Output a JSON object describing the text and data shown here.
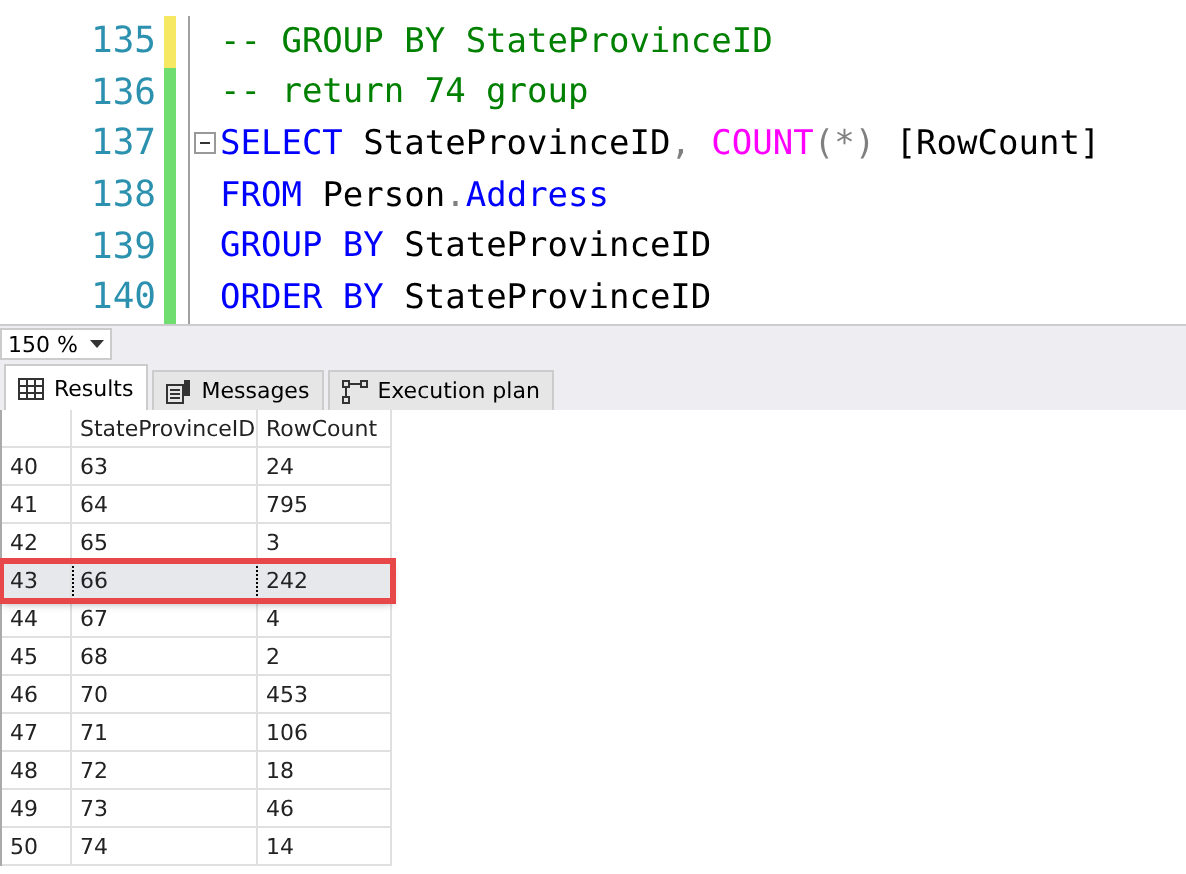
{
  "editor": {
    "lines": [
      {
        "number": "135",
        "kind": "unsaved",
        "collapsible": false,
        "tokens": [
          {
            "kind": "comment",
            "text": "-- GROUP BY StateProvinceID"
          }
        ]
      },
      {
        "number": "136",
        "kind": "saved",
        "collapsible": false,
        "tokens": [
          {
            "kind": "comment",
            "text": "-- return 74 group"
          }
        ]
      },
      {
        "number": "137",
        "kind": "saved",
        "collapsible": true,
        "tokens": [
          {
            "kind": "keyword",
            "text": "SELECT"
          },
          {
            "kind": "plain",
            "text": " StateProvinceID"
          },
          {
            "kind": "operator",
            "text": ", "
          },
          {
            "kind": "function",
            "text": "COUNT"
          },
          {
            "kind": "operator",
            "text": "(*)"
          },
          {
            "kind": "plain",
            "text": " [RowCount]"
          }
        ]
      },
      {
        "number": "138",
        "kind": "saved",
        "collapsible": false,
        "tokens": [
          {
            "kind": "keyword",
            "text": "FROM"
          },
          {
            "kind": "plain",
            "text": " Person"
          },
          {
            "kind": "operator",
            "text": "."
          },
          {
            "kind": "keyword",
            "text": "Address"
          }
        ]
      },
      {
        "number": "139",
        "kind": "saved",
        "collapsible": false,
        "tokens": [
          {
            "kind": "keyword",
            "text": "GROUP BY"
          },
          {
            "kind": "plain",
            "text": " StateProvinceID"
          }
        ]
      },
      {
        "number": "140",
        "kind": "saved",
        "collapsible": false,
        "tokens": [
          {
            "kind": "keyword",
            "text": "ORDER BY"
          },
          {
            "kind": "plain",
            "text": " StateProvinceID"
          }
        ]
      }
    ]
  },
  "zoom": {
    "value": "150 %"
  },
  "tabs": [
    {
      "label": "Results",
      "selected": true
    },
    {
      "label": "Messages",
      "selected": false
    },
    {
      "label": "Execution plan",
      "selected": false
    }
  ],
  "grid": {
    "columns": [
      "StateProvinceID",
      "RowCount"
    ],
    "rows": [
      {
        "number": "40",
        "cells": [
          "63",
          "24"
        ],
        "selected": false
      },
      {
        "number": "41",
        "cells": [
          "64",
          "795"
        ],
        "selected": false
      },
      {
        "number": "42",
        "cells": [
          "65",
          "3"
        ],
        "selected": false
      },
      {
        "number": "43",
        "cells": [
          "66",
          "242"
        ],
        "selected": true
      },
      {
        "number": "44",
        "cells": [
          "67",
          "4"
        ],
        "selected": false
      },
      {
        "number": "45",
        "cells": [
          "68",
          "2"
        ],
        "selected": false
      },
      {
        "number": "46",
        "cells": [
          "70",
          "453"
        ],
        "selected": false
      },
      {
        "number": "47",
        "cells": [
          "71",
          "106"
        ],
        "selected": false
      },
      {
        "number": "48",
        "cells": [
          "72",
          "18"
        ],
        "selected": false
      },
      {
        "number": "49",
        "cells": [
          "73",
          "46"
        ],
        "selected": false
      },
      {
        "number": "50",
        "cells": [
          "74",
          "14"
        ],
        "selected": false
      }
    ]
  }
}
